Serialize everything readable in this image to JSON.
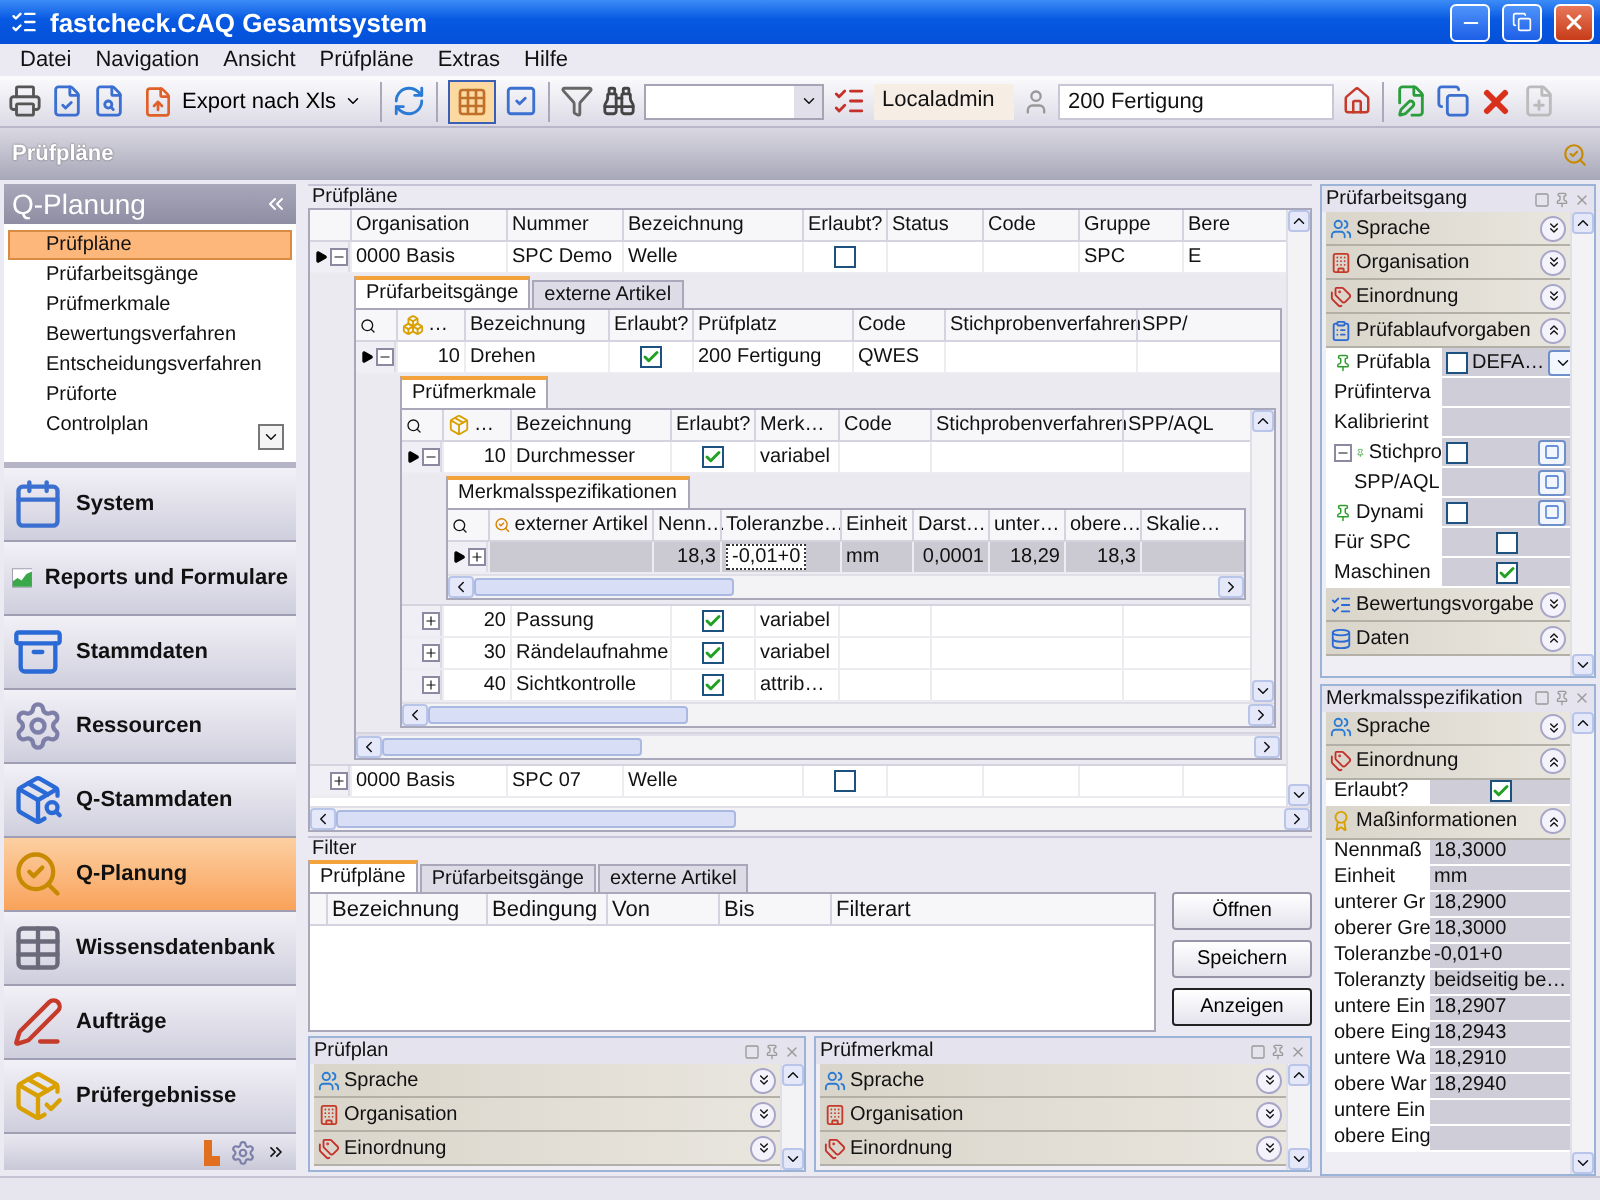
{
  "window": {
    "title": "fastcheck.CAQ Gesamtsystem"
  },
  "menu": [
    "Datei",
    "Navigation",
    "Ansicht",
    "Prüfpläne",
    "Extras",
    "Hilfe"
  ],
  "toolbar": {
    "export_label": "Export nach Xls",
    "grid_view_selected": true,
    "user": "Localadmin",
    "location": "200 Fertigung"
  },
  "page_title": "Prüfpläne",
  "sidebar": {
    "title": "Q-Planung",
    "items": [
      {
        "label": "Prüfpläne",
        "selected": true
      },
      {
        "label": "Prüfarbeitsgänge",
        "selected": false
      },
      {
        "label": "Prüfmerkmale",
        "selected": false
      },
      {
        "label": "Bewertungsverfahren",
        "selected": false
      },
      {
        "label": "Entscheidungsverfahren",
        "selected": false
      },
      {
        "label": "Prüforte",
        "selected": false
      },
      {
        "label": "Controlplan",
        "selected": false
      }
    ],
    "modules": [
      {
        "label": "System",
        "selected": false
      },
      {
        "label": "Reports und Formulare",
        "selected": false
      },
      {
        "label": "Stammdaten",
        "selected": false
      },
      {
        "label": "Ressourcen",
        "selected": false
      },
      {
        "label": "Q-Stammdaten",
        "selected": false
      },
      {
        "label": "Q-Planung",
        "selected": true
      },
      {
        "label": "Wissensdatenbank",
        "selected": false
      },
      {
        "label": "Aufträge",
        "selected": false
      },
      {
        "label": "Prüfergebnisse",
        "selected": false
      }
    ]
  },
  "plans": {
    "title": "Prüfpläne",
    "columns": [
      "Organisation",
      "Nummer",
      "Bezeichnung",
      "Erlaubt?",
      "Status",
      "Code",
      "Gruppe",
      "Bere"
    ],
    "rows": [
      {
        "selected": true,
        "expanded": true,
        "cells": [
          {
            "kind": "text",
            "text": "0000 Basis"
          },
          {
            "kind": "text",
            "text": "SPC Demo"
          },
          {
            "kind": "text",
            "text": "Welle"
          },
          {
            "kind": "check",
            "checked": false
          },
          {
            "kind": "empty"
          },
          {
            "kind": "empty"
          },
          {
            "kind": "text",
            "text": "SPC"
          },
          {
            "kind": "text",
            "text": "E"
          }
        ],
        "detail": {
          "tabs": [
            {
              "label": "Prüfarbeitsgänge",
              "selected": true
            },
            {
              "label": "externe Artikel",
              "selected": false
            }
          ],
          "columns": [
            "…",
            "Bezeichnung",
            "Erlaubt?",
            "Prüfplatz",
            "Code",
            "Stichprobenverfahren",
            "SPP/"
          ],
          "rows": [
            {
              "selected": true,
              "expanded": true,
              "cells": [
                {
                  "kind": "number",
                  "text": "10"
                },
                {
                  "kind": "text",
                  "text": "Drehen"
                },
                {
                  "kind": "check",
                  "checked": true
                },
                {
                  "kind": "text",
                  "text": "200 Fertigung"
                },
                {
                  "kind": "text",
                  "text": "QWES"
                },
                {
                  "kind": "empty"
                },
                {
                  "kind": "empty"
                }
              ],
              "detail": {
                "tabs": [
                  {
                    "label": "Prüfmerkmale",
                    "selected": true
                  }
                ],
                "columns": [
                  "…",
                  "Bezeichnung",
                  "Erlaubt?",
                  "Merk…",
                  "Code",
                  "Stichprobenverfahren",
                  "SPP/AQL"
                ],
                "rows": [
                  {
                    "selected": true,
                    "expanded": true,
                    "cells": [
                      {
                        "kind": "number",
                        "text": "10"
                      },
                      {
                        "kind": "text",
                        "text": "Durchmesser"
                      },
                      {
                        "kind": "check",
                        "checked": true
                      },
                      {
                        "kind": "text",
                        "text": "variabel"
                      },
                      {
                        "kind": "empty"
                      },
                      {
                        "kind": "empty"
                      },
                      {
                        "kind": "empty"
                      }
                    ],
                    "detail": {
                      "tabs": [
                        {
                          "label": "Merkmalsspezifikationen",
                          "selected": true
                        }
                      ],
                      "columns": [
                        "externer Artikel",
                        "Nenn…",
                        "Toleranzbe…",
                        "Einheit",
                        "Darst…",
                        "unter…",
                        "obere…",
                        "Skalie…"
                      ],
                      "rows": [
                        {
                          "selected": true,
                          "highlighted": true,
                          "expanded": false,
                          "cells": [
                            {
                              "kind": "empty"
                            },
                            {
                              "kind": "number",
                              "text": "18,3"
                            },
                            {
                              "kind": "edit",
                              "text": "-0,01+0"
                            },
                            {
                              "kind": "text",
                              "text": "mm"
                            },
                            {
                              "kind": "number",
                              "text": "0,0001"
                            },
                            {
                              "kind": "number",
                              "text": "18,29"
                            },
                            {
                              "kind": "number",
                              "text": "18,3"
                            },
                            {
                              "kind": "empty"
                            }
                          ]
                        }
                      ]
                    }
                  },
                  {
                    "selected": false,
                    "expanded": false,
                    "cells": [
                      {
                        "kind": "number",
                        "text": "20"
                      },
                      {
                        "kind": "text",
                        "text": "Passung"
                      },
                      {
                        "kind": "check",
                        "checked": true
                      },
                      {
                        "kind": "text",
                        "text": "variabel"
                      },
                      {
                        "kind": "empty"
                      },
                      {
                        "kind": "empty"
                      },
                      {
                        "kind": "empty"
                      }
                    ]
                  },
                  {
                    "selected": false,
                    "expanded": false,
                    "cells": [
                      {
                        "kind": "number",
                        "text": "30"
                      },
                      {
                        "kind": "text",
                        "text": "Rändelaufnahme"
                      },
                      {
                        "kind": "check",
                        "checked": true
                      },
                      {
                        "kind": "text",
                        "text": "variabel"
                      },
                      {
                        "kind": "empty"
                      },
                      {
                        "kind": "empty"
                      },
                      {
                        "kind": "empty"
                      }
                    ]
                  },
                  {
                    "selected": false,
                    "expanded": false,
                    "cells": [
                      {
                        "kind": "number",
                        "text": "40"
                      },
                      {
                        "kind": "text",
                        "text": "Sichtkontrolle"
                      },
                      {
                        "kind": "check",
                        "checked": true
                      },
                      {
                        "kind": "text",
                        "text": "attrib…"
                      },
                      {
                        "kind": "empty"
                      },
                      {
                        "kind": "empty"
                      },
                      {
                        "kind": "empty"
                      }
                    ]
                  }
                ]
              }
            }
          ]
        }
      },
      {
        "selected": false,
        "expanded": false,
        "cells": [
          {
            "kind": "text",
            "text": "0000 Basis"
          },
          {
            "kind": "text",
            "text": "SPC 07"
          },
          {
            "kind": "text",
            "text": "Welle"
          },
          {
            "kind": "check",
            "checked": false
          },
          {
            "kind": "empty"
          },
          {
            "kind": "empty"
          },
          {
            "kind": "empty"
          },
          {
            "kind": "empty"
          }
        ]
      }
    ]
  },
  "filter": {
    "title": "Filter",
    "tabs": [
      {
        "label": "Prüfpläne",
        "selected": true
      },
      {
        "label": "Prüfarbeitsgänge",
        "selected": false
      },
      {
        "label": "externe Artikel",
        "selected": false
      }
    ],
    "columns": [
      "Bezeichnung",
      "Bedingung",
      "Von",
      "Bis",
      "Filterart"
    ],
    "buttons": [
      {
        "label": "Öffnen",
        "default": false
      },
      {
        "label": "Speichern",
        "default": false
      },
      {
        "label": "Anzeigen",
        "default": true
      }
    ]
  },
  "bottom_panels": [
    {
      "title": "Prüfplan",
      "sections": [
        {
          "label": "Sprache",
          "expanded": false
        },
        {
          "label": "Organisation",
          "expanded": false
        },
        {
          "label": "Einordnung",
          "expanded": false
        }
      ]
    },
    {
      "title": "Prüfmerkmal",
      "sections": [
        {
          "label": "Sprache",
          "expanded": false
        },
        {
          "label": "Organisation",
          "expanded": false
        },
        {
          "label": "Einordnung",
          "expanded": false
        }
      ]
    }
  ],
  "right_panels": [
    {
      "title": "Prüfarbeitsgang",
      "sections": [
        {
          "label": "Sprache",
          "expanded": false
        },
        {
          "label": "Organisation",
          "expanded": false
        },
        {
          "label": "Einordnung",
          "expanded": false
        },
        {
          "label": "Prüfablaufvorgaben",
          "expanded": true,
          "properties": [
            {
              "label": "Prüfabla",
              "kind": "combo",
              "checked": false,
              "value": "DEFA…"
            },
            {
              "label": "Prüfinterva",
              "kind": "blank"
            },
            {
              "label": "Kalibrierint",
              "kind": "blank"
            },
            {
              "label": "Stichpro",
              "kind": "button",
              "checked": false,
              "expanded": true,
              "children": [
                {
                  "label": "SPP/AQL",
                  "kind": "button"
                }
              ]
            },
            {
              "label": "Dynami",
              "kind": "button",
              "checked": false
            },
            {
              "label": "Für SPC",
              "kind": "check",
              "checked": false
            },
            {
              "label": "Maschinen",
              "kind": "check",
              "checked": true
            }
          ]
        },
        {
          "label": "Bewertungsvorgabe",
          "expanded": false
        },
        {
          "label": "Daten",
          "expanded": true
        }
      ]
    },
    {
      "title": "Merkmalsspezifikation",
      "sections": [
        {
          "label": "Sprache",
          "expanded": false
        },
        {
          "label": "Einordnung",
          "expanded": true,
          "properties": [
            {
              "label": "Erlaubt?",
              "kind": "check",
              "checked": true
            }
          ]
        },
        {
          "label": "Maßinformationen",
          "expanded": true,
          "properties": [
            {
              "label": "Nennmaß",
              "kind": "value",
              "value": "18,3000"
            },
            {
              "label": "Einheit",
              "kind": "value",
              "value": "mm"
            },
            {
              "label": "unterer Gr",
              "kind": "value",
              "value": "18,2900"
            },
            {
              "label": "oberer Gre",
              "kind": "value",
              "value": "18,3000"
            },
            {
              "label": "Toleranzbe",
              "kind": "value",
              "value": "-0,01+0"
            },
            {
              "label": "Toleranzty",
              "kind": "value",
              "value": "beidseitig be…"
            },
            {
              "label": "untere Ein",
              "kind": "value",
              "value": "18,2907"
            },
            {
              "label": "obere Eing",
              "kind": "value",
              "value": "18,2943"
            },
            {
              "label": "untere Wa",
              "kind": "value",
              "value": "18,2910"
            },
            {
              "label": "obere War",
              "kind": "value",
              "value": "18,2940"
            },
            {
              "label": "untere Ein",
              "kind": "blank"
            },
            {
              "label": "obere Eing",
              "kind": "blank"
            }
          ]
        }
      ]
    }
  ]
}
